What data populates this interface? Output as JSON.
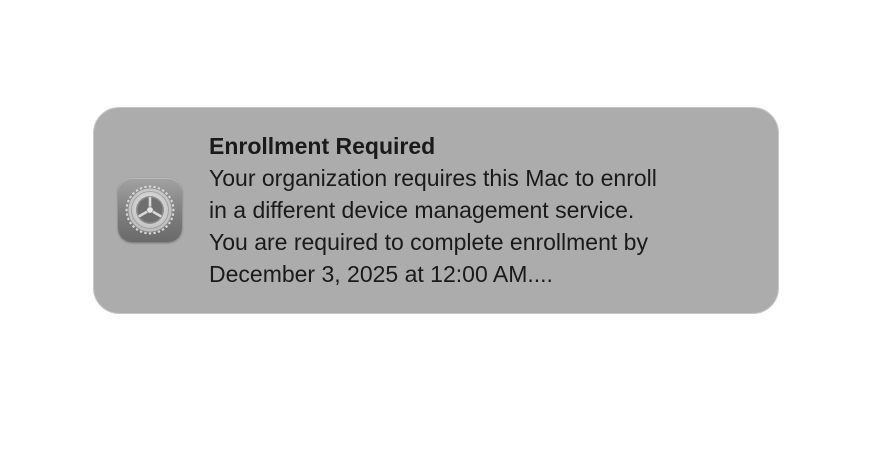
{
  "notification": {
    "app_icon": "system-settings-gear-icon",
    "title": "Enrollment Required",
    "message_lines": [
      "Your organization requires this Mac to enroll",
      "in a different device management service.",
      "You are required to complete enrollment by",
      "December 3, 2025 at 12:00 AM...."
    ],
    "background_color": "#acacac"
  }
}
